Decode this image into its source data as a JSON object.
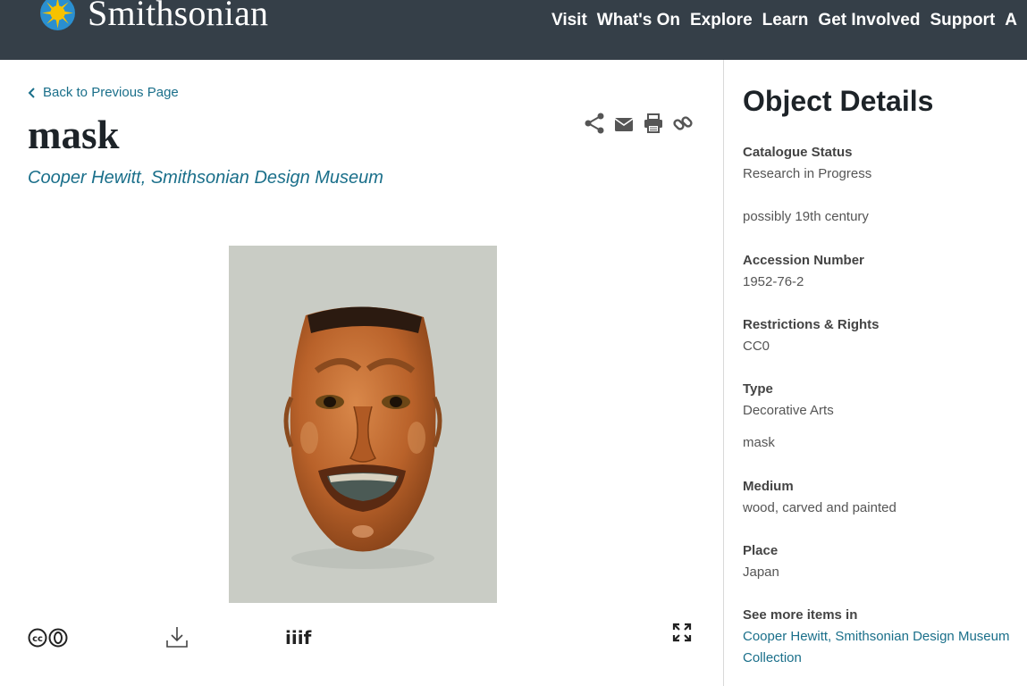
{
  "header": {
    "logo_text": "Smithsonian",
    "nav": [
      "Visit",
      "What's On",
      "Explore",
      "Learn",
      "Get Involved",
      "Support",
      "A"
    ]
  },
  "main": {
    "back_label": "Back to Previous Page",
    "title": "mask",
    "museum": "Cooper Hewitt, Smithsonian Design Museum",
    "share_icons": [
      "share-icon",
      "email-icon",
      "print-icon",
      "link-icon"
    ],
    "bottom_icons": [
      "creative-commons-zero-icon",
      "download-icon",
      "iiif-icon",
      "expand-icon"
    ]
  },
  "details": {
    "heading": "Object Details",
    "catalogue_status_label": "Catalogue Status",
    "catalogue_status": "Research in Progress",
    "date": "possibly 19th century",
    "accession_label": "Accession Number",
    "accession": "1952-76-2",
    "rights_label": "Restrictions & Rights",
    "rights": "CC0",
    "type_label": "Type",
    "type": "Decorative Arts",
    "type_sub": "mask",
    "medium_label": "Medium",
    "medium": "wood, carved and painted",
    "place_label": "Place",
    "place": "Japan",
    "see_more_label": "See more items in",
    "see_more_line1": "Cooper Hewitt, Smithsonian Design Museum",
    "see_more_line2": "Collection"
  },
  "colors": {
    "header_bg": "#353f48",
    "link": "#1a6f8a",
    "sun": "#f6c200"
  }
}
